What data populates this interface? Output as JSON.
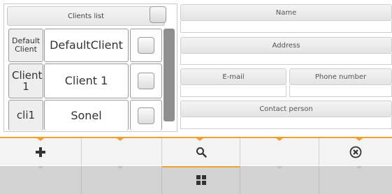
{
  "clients_list": {
    "header": "Clients list",
    "rows": [
      {
        "id": "Default Client",
        "name": "DefaultClient"
      },
      {
        "id": "Client 1",
        "name": "Client 1"
      },
      {
        "id": "cli1",
        "name": "Sonel"
      }
    ]
  },
  "form": {
    "name_label": "Name",
    "address_label": "Address",
    "email_label": "E-mail",
    "phone_label": "Phone number",
    "contact_label": "Contact person"
  },
  "toolbar": {
    "add_icon": "plus-icon",
    "search_icon": "magnifier-icon",
    "cancel_icon": "close-circle-icon",
    "menu_icon": "grid-icon"
  },
  "colors": {
    "accent": "#f0a030",
    "scrollbar": "#8f8f8f",
    "toolbar_bg": "#f3f3f3",
    "bottom_bar_bg": "#d3d3d3"
  }
}
